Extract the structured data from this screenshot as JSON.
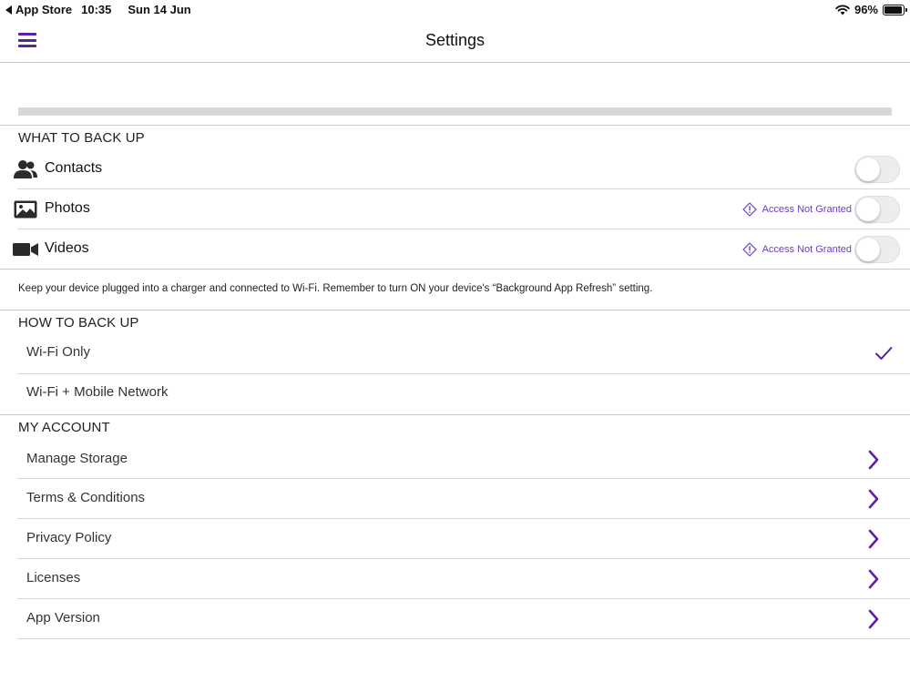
{
  "status_bar": {
    "back_app": "App Store",
    "time": "10:35",
    "date": "Sun 14 Jun",
    "battery": "96%",
    "battery_level": 0.96
  },
  "nav": {
    "title": "Settings",
    "menu_icon": "hamburger-menu-icon"
  },
  "progress": {
    "value": 0
  },
  "colors": {
    "accent": "#5b1fa8",
    "notice": "#6b3fc0",
    "divider": "#c8c8c8"
  },
  "what_to_back_up": {
    "header": "WHAT TO BACK UP",
    "items": [
      {
        "label": "Contacts",
        "icon": "contacts-icon",
        "on": false,
        "notice": ""
      },
      {
        "label": "Photos",
        "icon": "photo-icon",
        "on": false,
        "notice": "Access Not Granted"
      },
      {
        "label": "Videos",
        "icon": "video-camera-icon",
        "on": false,
        "notice": "Access Not Granted"
      }
    ]
  },
  "note": "Keep your device plugged into a charger and connected to Wi-Fi. Remember to turn ON your device's “Background App Refresh” setting.",
  "how_to_back_up": {
    "header": "HOW TO BACK UP",
    "options": [
      {
        "label": "Wi-Fi Only",
        "selected": true
      },
      {
        "label": "Wi-Fi + Mobile Network",
        "selected": false
      }
    ]
  },
  "my_account": {
    "header": "MY ACCOUNT",
    "items": [
      {
        "label": "Manage Storage"
      },
      {
        "label": "Terms & Conditions"
      },
      {
        "label": "Privacy Policy"
      },
      {
        "label": "Licenses"
      },
      {
        "label": "App Version"
      }
    ]
  }
}
